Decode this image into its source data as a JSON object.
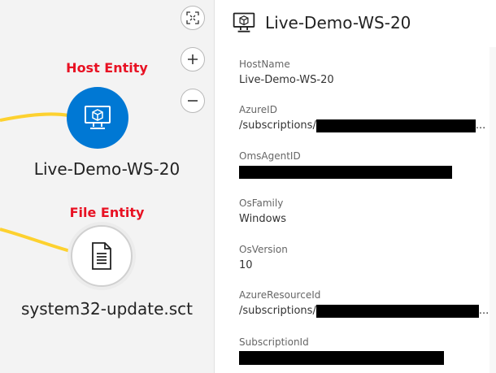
{
  "graph": {
    "controls": [
      {
        "name": "fit-to-screen-button",
        "icon": "fit-screen-icon"
      },
      {
        "name": "zoom-in-button",
        "icon": "plus-icon",
        "glyph": "+"
      },
      {
        "name": "zoom-out-button",
        "icon": "minus-icon",
        "glyph": "−"
      }
    ],
    "edge_color": "#fdd12f",
    "host": {
      "category_label": "Host Entity",
      "name": "Live-Demo-WS-20",
      "icon": "monitor-icon",
      "color": "#0078d4"
    },
    "file": {
      "category_label": "File Entity",
      "name": "system32-update.sct",
      "icon": "document-icon"
    },
    "label_color": "#e81123"
  },
  "panel": {
    "title": "Live-Demo-WS-20",
    "icon": "monitor-icon",
    "fields": [
      {
        "label": "HostName",
        "value": "Live-Demo-WS-20"
      },
      {
        "label": "AzureID",
        "prefix": "/subscriptions/",
        "redacted": true,
        "ellipsis": "..."
      },
      {
        "label": "OmsAgentID",
        "redacted": true
      },
      {
        "label": "OsFamily",
        "value": "Windows"
      },
      {
        "label": "OsVersion",
        "value": "10"
      },
      {
        "label": "AzureResourceId",
        "prefix": "/subscriptions/",
        "redacted": true,
        "ellipsis": "..."
      },
      {
        "label": "SubscriptionId",
        "redacted": true
      }
    ]
  }
}
